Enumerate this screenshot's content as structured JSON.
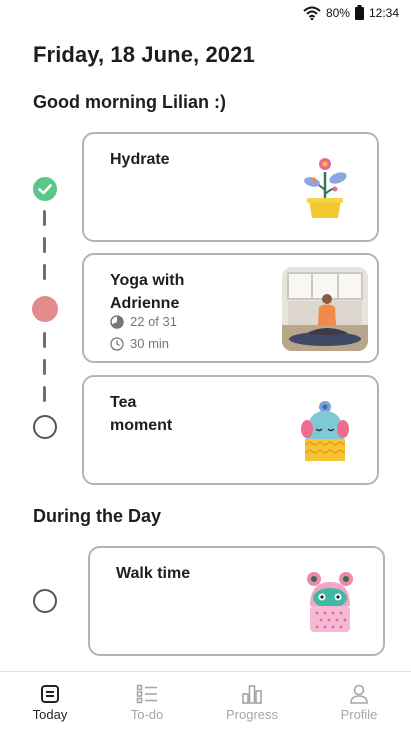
{
  "status": {
    "battery": "80%",
    "time": "12:34",
    "icons": [
      "wifi-icon",
      "battery-icon"
    ]
  },
  "date": "Friday, 18 June, 2021",
  "greeting": "Good morning Lilian :)",
  "morning_tasks": [
    {
      "title": "Hydrate",
      "state": "done",
      "illustration": "flower-pot-illustration"
    },
    {
      "title": "Yoga with\nAdrienne",
      "state": "in-progress",
      "progress": "22 of 31",
      "duration": "30 min",
      "illustration": "yoga-photo"
    },
    {
      "title": "Tea\nmoment",
      "state": "todo",
      "illustration": "tea-cozy-illustration"
    }
  ],
  "day_section": "During the Day",
  "day_tasks": [
    {
      "title": "Walk time",
      "state": "todo",
      "illustration": "creature-illustration"
    }
  ],
  "nav": [
    {
      "label": "Today",
      "icon": "today-icon",
      "active": true
    },
    {
      "label": "To-do",
      "icon": "list-icon",
      "active": false
    },
    {
      "label": "Progress",
      "icon": "bar-chart-icon",
      "active": false
    },
    {
      "label": "Profile",
      "icon": "person-icon",
      "active": false
    }
  ],
  "colors": {
    "done": "#5cc58a",
    "in_progress": "#e38a8a",
    "todo_ring": "#555555",
    "card_border": "#b4b4b4",
    "inactive_nav": "#a6a6a6"
  }
}
